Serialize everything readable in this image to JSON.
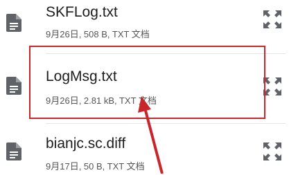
{
  "files": [
    {
      "name": "SKFLog.txt",
      "meta": "9月26日, 508 B, TXT 文档",
      "icon": "document-icon",
      "action_icon": "expand-icon"
    },
    {
      "name": "LogMsg.txt",
      "meta": "9月26日, 2.81 kB, TXT 文档",
      "icon": "document-icon",
      "action_icon": "expand-icon"
    },
    {
      "name": "bianjc.sc.diff",
      "meta": "9月17日, 50 B, TXT 文档",
      "icon": "document-icon",
      "action_icon": "expand-icon"
    }
  ],
  "annotation": {
    "color": "#c8262a",
    "highlighted_item": "LogMsg.txt"
  },
  "colors": {
    "icon": "#5f6368",
    "text": "#1d1d1d",
    "meta": "#555555"
  }
}
